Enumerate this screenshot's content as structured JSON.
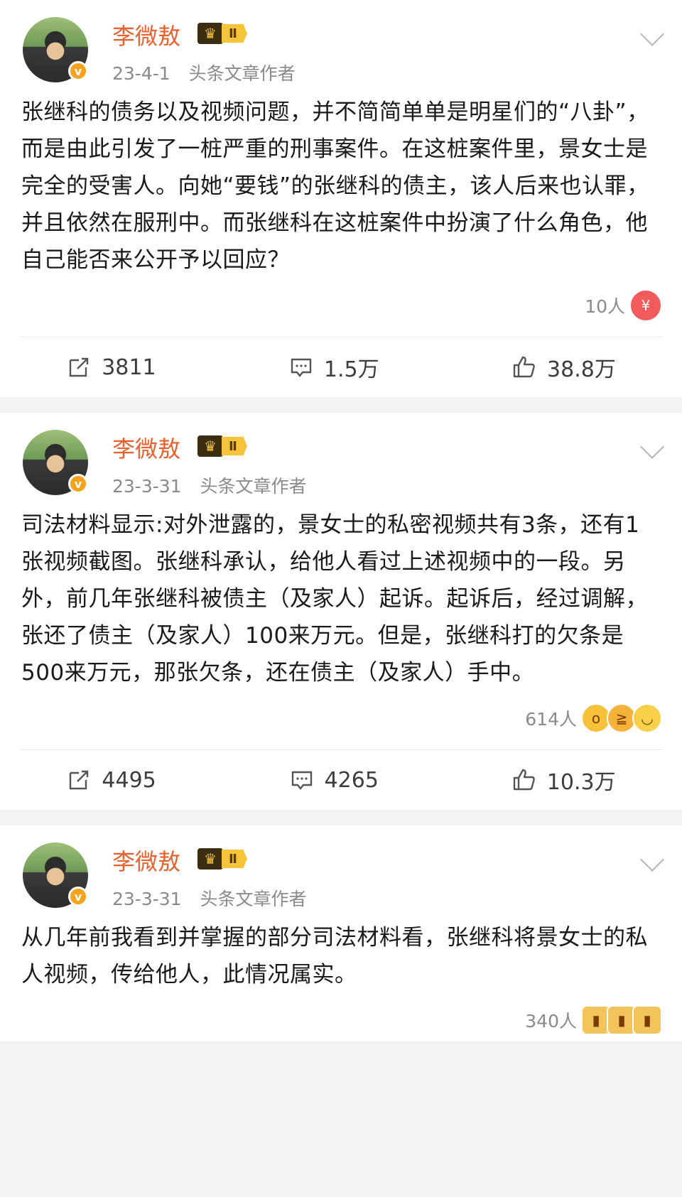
{
  "posts": [
    {
      "username": "李微敖",
      "level": "Ⅱ",
      "date": "23-4-1",
      "source": "头条文章作者",
      "text": "张继科的债务以及视频问题，并不简简单单是明星们的“八卦”，而是由此引发了一桩严重的刑事案件。在这桩案件里，景女士是完全的受害人。向她“要钱”的张继科的债主，该人后来也认罪，并且依然在服刑中。而张继科在这桩案件中扮演了什么角色，他自己能否来公开予以回应？",
      "reactions": "10人",
      "reaction_icons": [
        "heart-icon"
      ],
      "repost": "3811",
      "comment": "1.5万",
      "like": "38.8万"
    },
    {
      "username": "李微敖",
      "level": "Ⅱ",
      "date": "23-3-31",
      "source": "头条文章作者",
      "text": "司法材料显示:对外泄露的，景女士的私密视频共有3条，还有1张视频截图。张继科承认，给他人看过上述视频中的一段。另外，前几年张继科被债主（及家人）起诉。起诉后，经过调解，张还了债主（及家人）100来万元。但是，张继科打的欠条是500来万元，那张欠条，还在债主（及家人）手中。",
      "reactions": "614人",
      "reaction_icons": [
        "surprise-emoji",
        "laugh-emoji",
        "grin-emoji"
      ],
      "repost": "4495",
      "comment": "4265",
      "like": "10.3万"
    },
    {
      "username": "李微敖",
      "level": "Ⅱ",
      "date": "23-3-31",
      "source": "头条文章作者",
      "text": "从几年前我看到并掌握的部分司法材料看，张继科将景女士的私人视频，传给他人，此情况属实。",
      "reactions": "340人",
      "reaction_icons": [
        "clap-emoji",
        "clap-emoji",
        "clap-emoji"
      ]
    }
  ]
}
